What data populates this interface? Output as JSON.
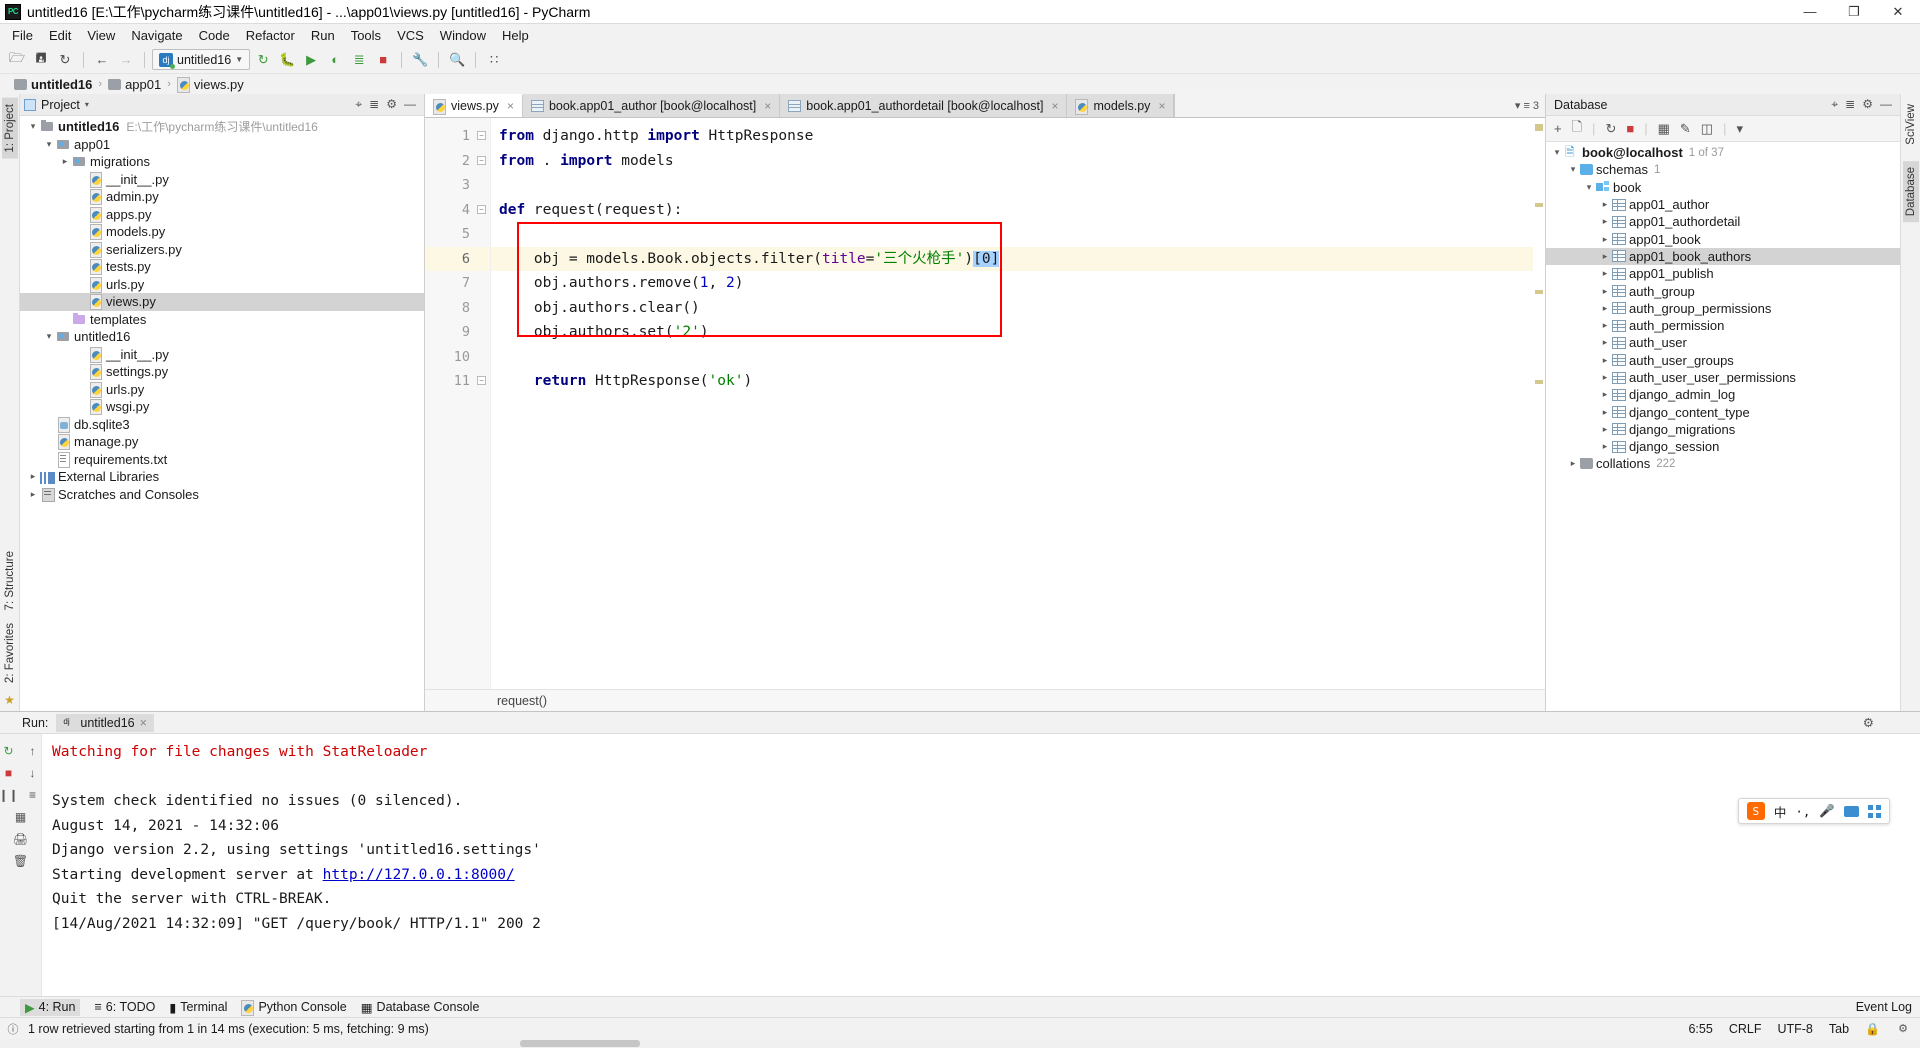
{
  "window": {
    "title": "untitled16 [E:\\工作\\pycharm练习课件\\untitled16] - ...\\app01\\views.py [untitled16] - PyCharm",
    "logo": "PC",
    "minimize": "—",
    "maximize": "❐",
    "close": "✕"
  },
  "menu": {
    "items": [
      "File",
      "Edit",
      "View",
      "Navigate",
      "Code",
      "Refactor",
      "Run",
      "Tools",
      "VCS",
      "Window",
      "Help"
    ]
  },
  "toolbar": {
    "open_icon": "▰",
    "save_icon": "ὋE",
    "sync_icon": "↻",
    "back_icon": "←",
    "forward_icon": "→",
    "run_config": "untitled16",
    "run_config_caret": "⌄",
    "rerun_icon": "↻",
    "debug_icon": "ὁE",
    "coverage_icon": "▶",
    "profile_icon": "◔",
    "console_icon": "≡",
    "stop_icon": "■",
    "wrench_icon": "ὒ7",
    "search_icon": "ὐD",
    "struct_icon": "⎇"
  },
  "breadcrumb": {
    "items": [
      {
        "label": "untitled16",
        "icon": "folder-icon"
      },
      {
        "label": "app01",
        "icon": "folder-icon"
      },
      {
        "label": "views.py",
        "icon": "python-file-icon"
      }
    ],
    "separator": "›"
  },
  "left_strip": {
    "project_tab": "1: Project",
    "structure_tab": "7: Structure",
    "favorites_tab": "2: Favorites"
  },
  "right_strip": {
    "sciview_tab": "SciView",
    "database_tab": "Database"
  },
  "project_panel": {
    "title": "Project",
    "caret": "▾",
    "icons": [
      "target-icon",
      "collapse-icon",
      "gear-icon",
      "hide-icon"
    ],
    "tree": [
      {
        "label": "untitled16",
        "path": "E:\\工作\\pycharm练习课件\\untitled16",
        "indent": 0,
        "arrow": "open",
        "icon": "folder",
        "bold": true
      },
      {
        "label": "app01",
        "indent": 1,
        "arrow": "open",
        "icon": "folder-src"
      },
      {
        "label": "migrations",
        "indent": 2,
        "arrow": "closed",
        "icon": "folder-src"
      },
      {
        "label": "__init__.py",
        "indent": 3,
        "arrow": "none",
        "icon": "py"
      },
      {
        "label": "admin.py",
        "indent": 3,
        "arrow": "none",
        "icon": "py"
      },
      {
        "label": "apps.py",
        "indent": 3,
        "arrow": "none",
        "icon": "py"
      },
      {
        "label": "models.py",
        "indent": 3,
        "arrow": "none",
        "icon": "py"
      },
      {
        "label": "serializers.py",
        "indent": 3,
        "arrow": "none",
        "icon": "py"
      },
      {
        "label": "tests.py",
        "indent": 3,
        "arrow": "none",
        "icon": "py"
      },
      {
        "label": "urls.py",
        "indent": 3,
        "arrow": "none",
        "icon": "py"
      },
      {
        "label": "views.py",
        "indent": 3,
        "arrow": "none",
        "icon": "py",
        "selected": true
      },
      {
        "label": "templates",
        "indent": 2,
        "arrow": "none",
        "icon": "folder-tpl"
      },
      {
        "label": "untitled16",
        "indent": 1,
        "arrow": "open",
        "icon": "folder-src"
      },
      {
        "label": "__init__.py",
        "indent": 3,
        "arrow": "none",
        "icon": "py"
      },
      {
        "label": "settings.py",
        "indent": 3,
        "arrow": "none",
        "icon": "py"
      },
      {
        "label": "urls.py",
        "indent": 3,
        "arrow": "none",
        "icon": "py"
      },
      {
        "label": "wsgi.py",
        "indent": 3,
        "arrow": "none",
        "icon": "py"
      },
      {
        "label": "db.sqlite3",
        "indent": 1,
        "arrow": "none",
        "icon": "db"
      },
      {
        "label": "manage.py",
        "indent": 1,
        "arrow": "none",
        "icon": "py"
      },
      {
        "label": "requirements.txt",
        "indent": 1,
        "arrow": "none",
        "icon": "txt"
      },
      {
        "label": "External Libraries",
        "indent": 0,
        "arrow": "closed",
        "icon": "lib"
      },
      {
        "label": "Scratches and Consoles",
        "indent": 0,
        "arrow": "closed",
        "icon": "scratch"
      }
    ]
  },
  "editor": {
    "tabs": [
      {
        "label": "views.py",
        "icon": "python-file-icon",
        "active": true,
        "close": "×"
      },
      {
        "label": "book.app01_author [book@localhost]",
        "icon": "table-icon",
        "active": false,
        "close": "×"
      },
      {
        "label": "book.app01_authordetail [book@localhost]",
        "icon": "table-icon",
        "active": false,
        "close": "×"
      },
      {
        "label": "models.py",
        "icon": "python-file-icon",
        "active": false,
        "close": "×"
      }
    ],
    "tab_overflow": "3",
    "line_numbers": [
      "1",
      "2",
      "3",
      "4",
      "5",
      "6",
      "7",
      "8",
      "9",
      "10",
      "11"
    ],
    "current_line": 6,
    "code_lines": [
      {
        "n": 1,
        "tokens": [
          {
            "t": "from",
            "c": "kw"
          },
          {
            "t": " django.http ",
            "c": ""
          },
          {
            "t": "import",
            "c": "kw"
          },
          {
            "t": " HttpResponse",
            "c": ""
          }
        ]
      },
      {
        "n": 2,
        "tokens": [
          {
            "t": "from",
            "c": "kw"
          },
          {
            "t": " . ",
            "c": ""
          },
          {
            "t": "import",
            "c": "kw"
          },
          {
            "t": " models",
            "c": ""
          }
        ]
      },
      {
        "n": 3,
        "tokens": []
      },
      {
        "n": 4,
        "tokens": [
          {
            "t": "def",
            "c": "kw"
          },
          {
            "t": " request(request):",
            "c": ""
          }
        ]
      },
      {
        "n": 5,
        "tokens": []
      },
      {
        "n": 6,
        "tokens": [
          {
            "t": "    obj = models.Book.objects.filter(",
            "c": ""
          },
          {
            "t": "title",
            "c": "param"
          },
          {
            "t": "=",
            "c": ""
          },
          {
            "t": "'三个火枪手'",
            "c": "str"
          },
          {
            "t": ")",
            "c": ""
          },
          {
            "t": "[0]",
            "c": "sel"
          }
        ]
      },
      {
        "n": 7,
        "tokens": [
          {
            "t": "    obj.authors.remove(",
            "c": ""
          },
          {
            "t": "1",
            "c": "num"
          },
          {
            "t": ", ",
            "c": ""
          },
          {
            "t": "2",
            "c": "num"
          },
          {
            "t": ")",
            "c": ""
          }
        ]
      },
      {
        "n": 8,
        "tokens": [
          {
            "t": "    obj.authors.clear()",
            "c": ""
          }
        ]
      },
      {
        "n": 9,
        "tokens": [
          {
            "t": "    obj.authors.set(",
            "c": ""
          },
          {
            "t": "'2'",
            "c": "str"
          },
          {
            "t": ")",
            "c": ""
          }
        ]
      },
      {
        "n": 10,
        "tokens": []
      },
      {
        "n": 11,
        "tokens": [
          {
            "t": "    ",
            "c": ""
          },
          {
            "t": "return",
            "c": "kw"
          },
          {
            "t": " HttpResponse(",
            "c": ""
          },
          {
            "t": "'ok'",
            "c": "str"
          },
          {
            "t": ")",
            "c": ""
          }
        ]
      }
    ],
    "status_breadcrumb": "request()"
  },
  "database_panel": {
    "title": "Database",
    "toolbar_icons": [
      "add-icon",
      "copy-icon",
      "refresh-icon",
      "stop-icon",
      "table-icon",
      "edit-icon",
      "console-icon",
      "filter-icon"
    ],
    "header_icons": [
      "target-icon",
      "collapse-icon",
      "gear-icon",
      "hide-icon"
    ],
    "tree": [
      {
        "label": "book@localhost",
        "count": "1 of 37",
        "indent": 0,
        "arrow": "open",
        "icon": "conn",
        "bold": true
      },
      {
        "label": "schemas",
        "count": "1",
        "indent": 1,
        "arrow": "open",
        "icon": "schemas"
      },
      {
        "label": "book",
        "indent": 2,
        "arrow": "open",
        "icon": "schema"
      },
      {
        "label": "app01_author",
        "indent": 3,
        "arrow": "closed",
        "icon": "table"
      },
      {
        "label": "app01_authordetail",
        "indent": 3,
        "arrow": "closed",
        "icon": "table"
      },
      {
        "label": "app01_book",
        "indent": 3,
        "arrow": "closed",
        "icon": "table"
      },
      {
        "label": "app01_book_authors",
        "indent": 3,
        "arrow": "closed",
        "icon": "table",
        "selected": true
      },
      {
        "label": "app01_publish",
        "indent": 3,
        "arrow": "closed",
        "icon": "table"
      },
      {
        "label": "auth_group",
        "indent": 3,
        "arrow": "closed",
        "icon": "table"
      },
      {
        "label": "auth_group_permissions",
        "indent": 3,
        "arrow": "closed",
        "icon": "table"
      },
      {
        "label": "auth_permission",
        "indent": 3,
        "arrow": "closed",
        "icon": "table"
      },
      {
        "label": "auth_user",
        "indent": 3,
        "arrow": "closed",
        "icon": "table"
      },
      {
        "label": "auth_user_groups",
        "indent": 3,
        "arrow": "closed",
        "icon": "table"
      },
      {
        "label": "auth_user_user_permissions",
        "indent": 3,
        "arrow": "closed",
        "icon": "table"
      },
      {
        "label": "django_admin_log",
        "indent": 3,
        "arrow": "closed",
        "icon": "table"
      },
      {
        "label": "django_content_type",
        "indent": 3,
        "arrow": "closed",
        "icon": "table"
      },
      {
        "label": "django_migrations",
        "indent": 3,
        "arrow": "closed",
        "icon": "table"
      },
      {
        "label": "django_session",
        "indent": 3,
        "arrow": "closed",
        "icon": "table"
      },
      {
        "label": "collations",
        "count": "222",
        "indent": 1,
        "arrow": "closed",
        "icon": "collation"
      }
    ]
  },
  "run_panel": {
    "label": "Run:",
    "tab_label": "untitled16",
    "tab_close": "×",
    "gear_icon": "⚙",
    "tool_icons": [
      "rerun-icon",
      "scroll-up-icon",
      "stop-icon",
      "scroll-down-icon",
      "pause-icon",
      "soft-wrap-icon",
      "print-icon",
      "grid-icon",
      "trash-icon"
    ],
    "console_lines": [
      {
        "text": "Watching for file changes with StatReloader",
        "style": "warn"
      },
      {
        "text": "",
        "style": "plain"
      },
      {
        "text": "System check identified no issues (0 silenced).",
        "style": "plain"
      },
      {
        "text": "August 14, 2021 - 14:32:06",
        "style": "plain"
      },
      {
        "text": "Django version 2.2, using settings 'untitled16.settings'",
        "style": "plain"
      },
      {
        "text": "Starting development server at ",
        "style": "plain",
        "link": "http://127.0.0.1:8000/"
      },
      {
        "text": "Quit the server with CTRL-BREAK.",
        "style": "plain"
      },
      {
        "text": "[14/Aug/2021 14:32:09] \"GET /query/book/ HTTP/1.1\" 200 2",
        "style": "plain"
      }
    ]
  },
  "ime": {
    "logo": "S",
    "mode": "中",
    "punct": "·,",
    "mic": "Ἲ4",
    "keyboard": "keyboard-icon",
    "toolbox": "toolbox-icon"
  },
  "bottom_bar": {
    "items": [
      {
        "label": "4: Run",
        "icon": "run-icon",
        "selected": true
      },
      {
        "label": "6: TODO",
        "icon": "todo-icon"
      },
      {
        "label": "Terminal",
        "icon": "terminal-icon"
      },
      {
        "label": "Python Console",
        "icon": "python-icon"
      },
      {
        "label": "Database Console",
        "icon": "database-icon"
      }
    ],
    "event_log": "Event Log"
  },
  "status_bar": {
    "message": "1 row retrieved starting from 1 in 14 ms (execution: 5 ms, fetching: 9 ms)",
    "caret": "6:55",
    "line_sep": "CRLF",
    "encoding": "UTF-8",
    "indent": "Tab",
    "lock_icon": "ὑ2",
    "divider": "÷"
  }
}
